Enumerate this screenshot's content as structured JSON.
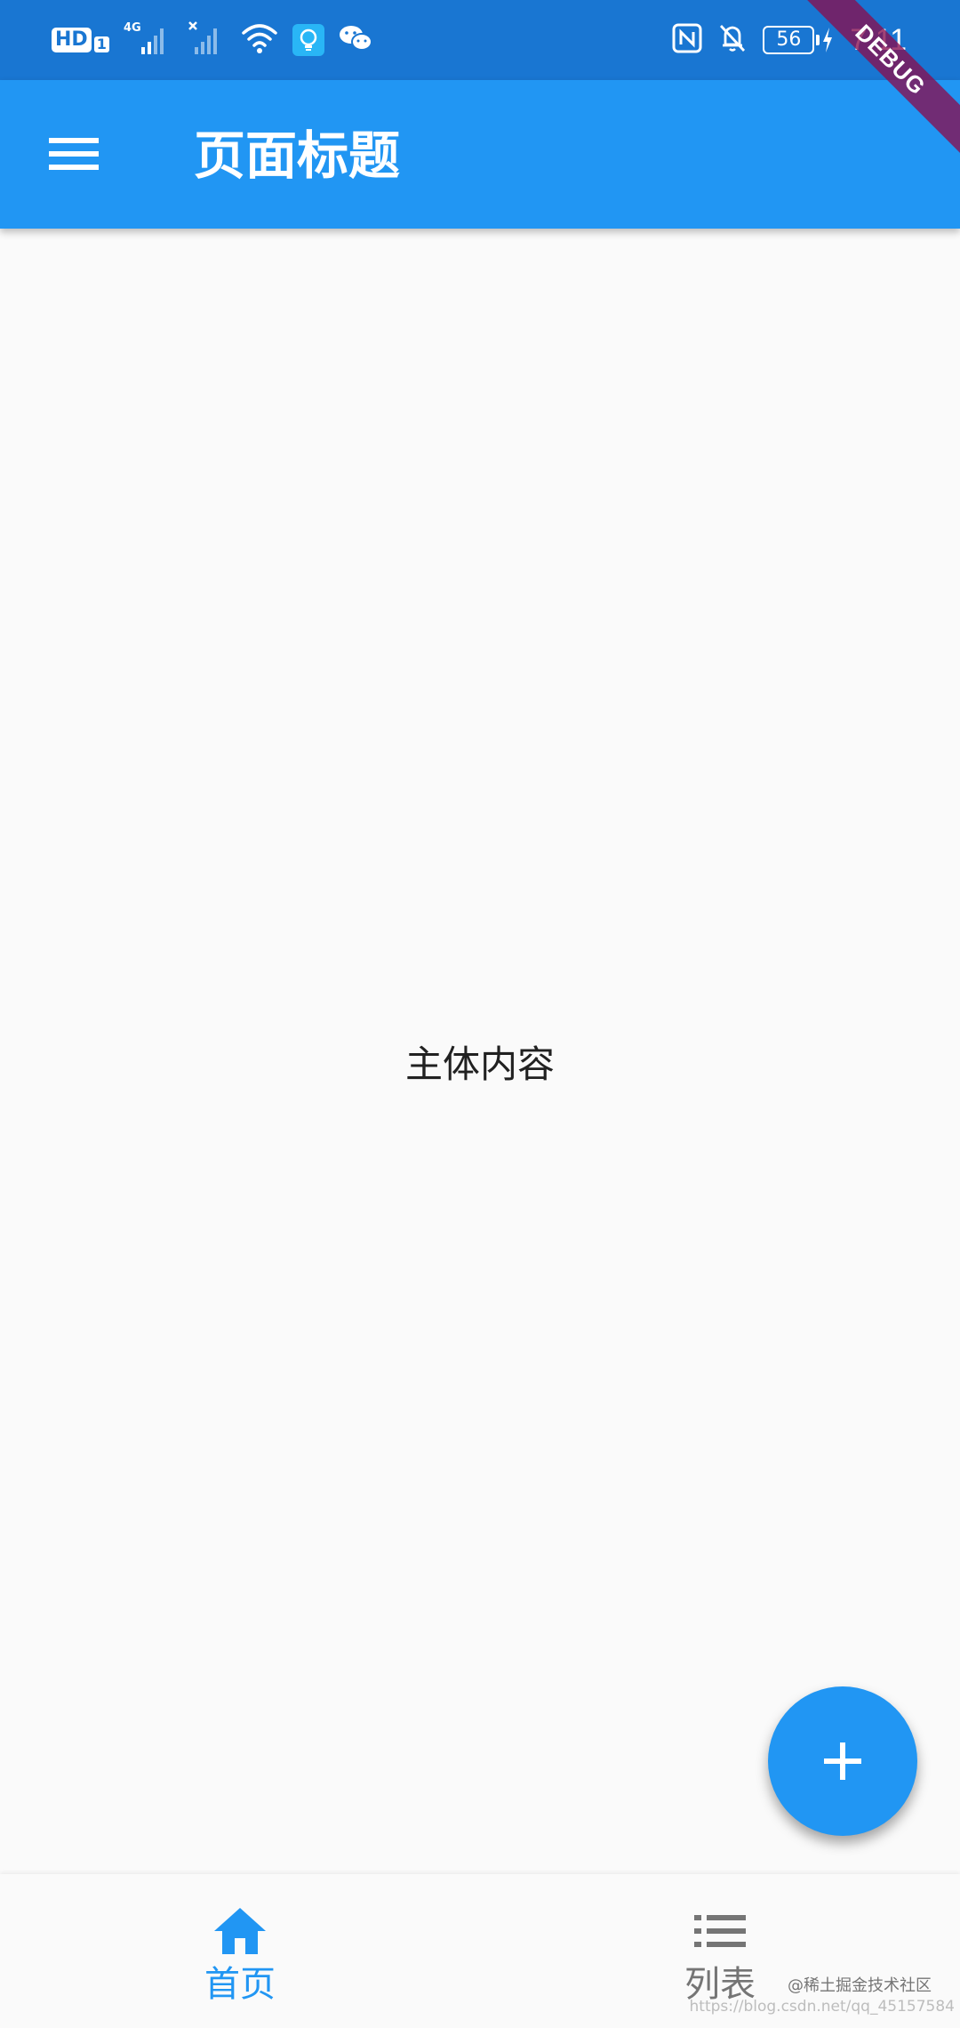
{
  "status_bar": {
    "hd_label": "HD",
    "sim_label": "1",
    "network_label": "4G",
    "battery_level": "56",
    "time": "7:11"
  },
  "debug_banner": "DEBUG",
  "app_bar": {
    "title": "页面标题"
  },
  "body": {
    "text": "主体内容"
  },
  "bottom_nav": {
    "items": [
      {
        "label": "首页",
        "icon": "home-icon",
        "active": true
      },
      {
        "label": "列表",
        "icon": "list-icon",
        "active": false
      }
    ]
  },
  "watermark": {
    "text": "@稀土掘金技术社区",
    "url": "https://blog.csdn.net/qq_45157584"
  },
  "colors": {
    "primary": "#2196f3",
    "status_bar": "#1976d2",
    "inactive": "#757575",
    "background": "#fafafa"
  }
}
